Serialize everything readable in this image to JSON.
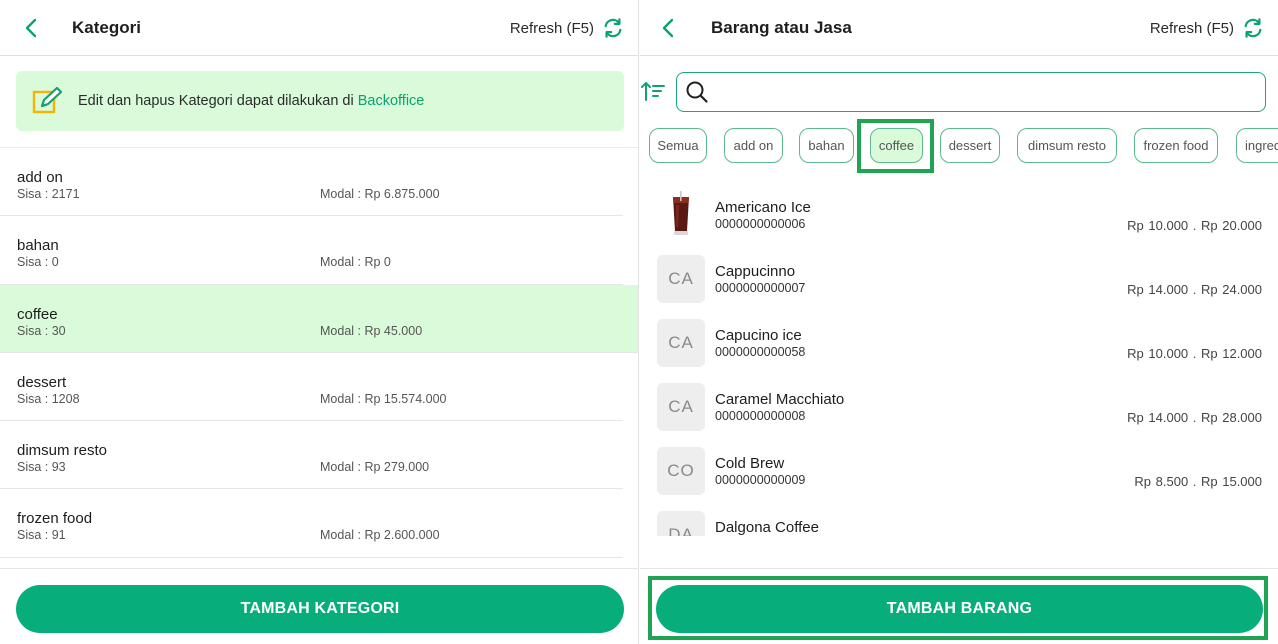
{
  "left": {
    "title": "Kategori",
    "refresh_label": "Refresh (F5)",
    "banner": {
      "text": "Edit dan hapus Kategori dapat dilakukan di",
      "link": "Backoffice"
    },
    "categories": [
      {
        "name": "add on",
        "sisa": "Sisa : 2171",
        "modal": "Modal : Rp 6.875.000",
        "selected": false
      },
      {
        "name": "bahan",
        "sisa": "Sisa : 0",
        "modal": "Modal : Rp 0",
        "selected": false
      },
      {
        "name": "coffee",
        "sisa": "Sisa : 30",
        "modal": "Modal : Rp 45.000",
        "selected": true
      },
      {
        "name": "dessert",
        "sisa": "Sisa : 1208",
        "modal": "Modal : Rp 15.574.000",
        "selected": false
      },
      {
        "name": "dimsum resto",
        "sisa": "Sisa : 93",
        "modal": "Modal : Rp 279.000",
        "selected": false
      },
      {
        "name": "frozen food",
        "sisa": "Sisa : 91",
        "modal": "Modal : Rp 2.600.000",
        "selected": false
      }
    ],
    "add_button": "TAMBAH KATEGORI"
  },
  "right": {
    "title": "Barang atau Jasa",
    "refresh_label": "Refresh (F5)",
    "search": {
      "value": "",
      "placeholder": ""
    },
    "chips": [
      "Semua",
      "add on",
      "bahan",
      "coffee",
      "dessert",
      "dimsum resto",
      "frozen food",
      "ingredients"
    ],
    "active_chip": "coffee",
    "products": [
      {
        "name": "Americano Ice",
        "code": "0000000000006",
        "price": "Rp 10.000  .  Rp 20.000",
        "initials": "",
        "photo": true
      },
      {
        "name": "Cappucinno",
        "code": "0000000000007",
        "price": "Rp 14.000  .  Rp 24.000",
        "initials": "CA",
        "photo": false
      },
      {
        "name": "Capucino ice",
        "code": "0000000000058",
        "price": "Rp 10.000  .  Rp 12.000",
        "initials": "CA",
        "photo": false
      },
      {
        "name": "Caramel Macchiato",
        "code": "0000000000008",
        "price": "Rp 14.000  .  Rp 28.000",
        "initials": "CA",
        "photo": false
      },
      {
        "name": "Cold Brew",
        "code": "0000000000009",
        "price": "Rp 8.500  .  Rp 15.000",
        "initials": "CO",
        "photo": false
      },
      {
        "name": "Dalgona Coffee",
        "code": "",
        "price": "",
        "initials": "DA",
        "photo": false
      }
    ],
    "add_button": "TAMBAH BARANG"
  },
  "colors": {
    "accent": "#07ae7c",
    "selected_bg": "#d9fbd9",
    "highlight": "#20a352"
  },
  "icons": [
    "chevron-left-icon",
    "refresh-icon",
    "edit-note-icon",
    "sort-icon",
    "search-icon"
  ]
}
